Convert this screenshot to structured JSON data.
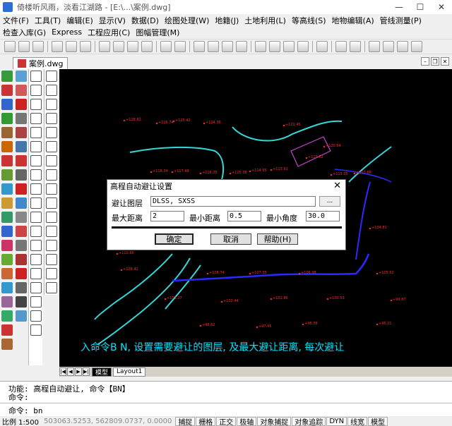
{
  "window": {
    "title": "倚楼听风雨，淡看江湖路 - [E:\\...\\案例.dwg]",
    "minimize": "—",
    "maximize": "☐",
    "close": "✕"
  },
  "menu1": [
    "文件(F)",
    "工具(T)",
    "编辑(E)",
    "显示(V)",
    "数据(D)",
    "绘图处理(W)",
    "地籍(J)",
    "土地利用(L)",
    "等高线(S)",
    "地物编辑(A)",
    "管线测量(P)"
  ],
  "menu2": [
    "检查入库(G)",
    "Express",
    "工程应用(C)",
    "图幅管理(M)"
  ],
  "doc_tab": {
    "label": "案例.dwg"
  },
  "canvas": {
    "prompt": "入命令B N, 设置需要避让的图层, 及最大避让距离, 每次避让"
  },
  "layout_tabs": [
    "模型",
    "Layout1"
  ],
  "command": {
    "line1": "功能: 高程自动避让, 命令【BN】",
    "line2": "命令:",
    "line3": "命令: bn"
  },
  "status": {
    "scale": "比例 1:500",
    "coords": "503063.5253, 562809.0737, 0.0000",
    "buttons": [
      "捕捉",
      "栅格",
      "正交",
      "极轴",
      "对象捕捉",
      "对象追踪",
      "DYN",
      "线宽",
      "模型"
    ]
  },
  "dialog": {
    "title": "高程自动避让设置",
    "close": "✕",
    "layers_label": "避让图层",
    "layers_value": "DLSS, SXSS",
    "browse": "...",
    "max_dist_label": "最大距离",
    "max_dist_value": "2",
    "min_dist_label": "最小距离",
    "min_dist_value": "0.5",
    "min_angle_label": "最小角度",
    "min_angle_value": "30.0",
    "ok": "确定",
    "cancel": "取消",
    "help": "帮助(H)"
  },
  "colors": {
    "canvas_bg": "#000000",
    "elevation_points": "#ff2a2a",
    "contour_lines": "#34d8d8",
    "road_line": "#2a2aff",
    "building": "#cc44cc",
    "prompt_text": "#00e5ff"
  }
}
